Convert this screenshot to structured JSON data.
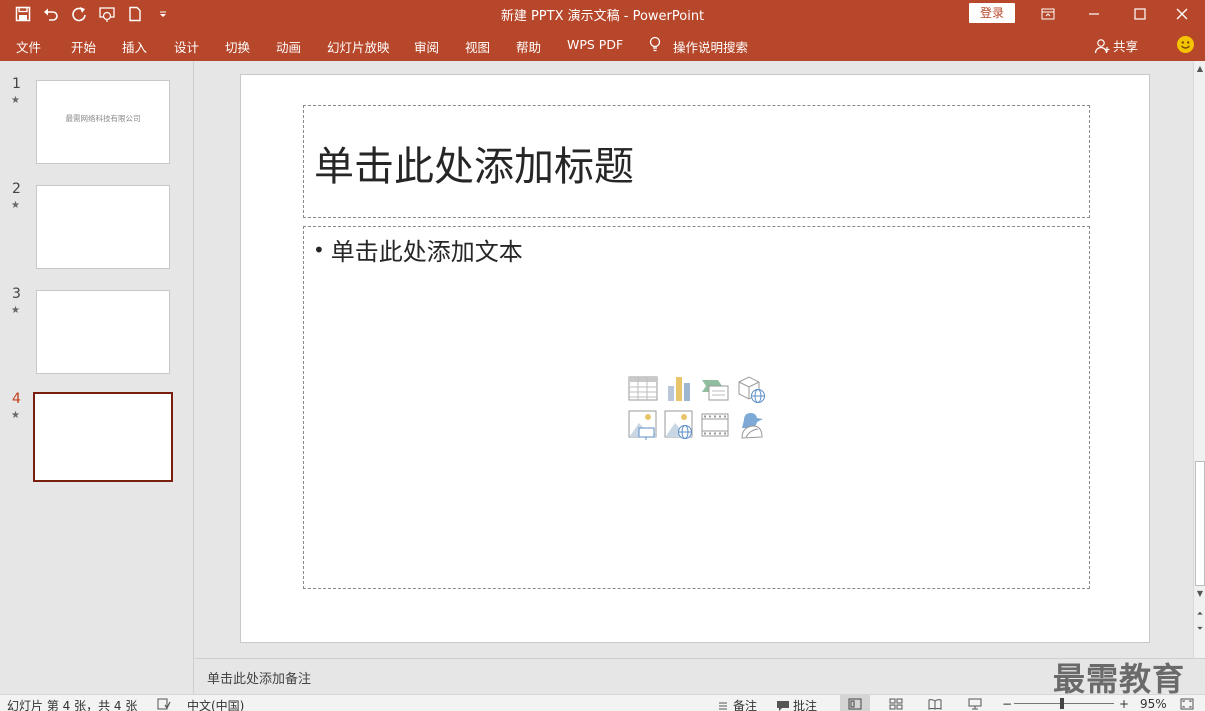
{
  "app": {
    "window_title": "新建 PPTX 演示文稿  -  PowerPoint",
    "login_label": "登录",
    "accent": "#b7472a"
  },
  "quick_access": [
    {
      "icon": "save-icon"
    },
    {
      "icon": "undo-icon"
    },
    {
      "icon": "redo-icon"
    },
    {
      "icon": "present-from-start-icon"
    },
    {
      "icon": "new-file-icon"
    },
    {
      "icon": "customize-dropdown-icon"
    }
  ],
  "ribbon": {
    "tabs": [
      "文件",
      "开始",
      "插入",
      "设计",
      "切换",
      "动画",
      "幻灯片放映",
      "审阅",
      "视图",
      "帮助",
      "WPS PDF"
    ],
    "tell_me": "操作说明搜索",
    "share": "共享"
  },
  "thumbnails": [
    {
      "number": "1",
      "star": "★",
      "text": "最需网络科技有限公司"
    },
    {
      "number": "2",
      "star": "★",
      "text": ""
    },
    {
      "number": "3",
      "star": "★",
      "text": ""
    },
    {
      "number": "4",
      "star": "★",
      "text": ""
    }
  ],
  "slide": {
    "title_placeholder": "单击此处添加标题",
    "body_placeholder": "单击此处添加文本",
    "bullet": "•"
  },
  "notes_placeholder": "单击此处添加备注",
  "watermark": "最需教育",
  "status": {
    "slide_count": "幻灯片 第 4 张，共 4 张",
    "language": "中文(中国)",
    "notes_label": "备注",
    "comments_label": "批注",
    "zoom_minus": "−",
    "zoom_plus": "+",
    "zoom": "95%"
  }
}
